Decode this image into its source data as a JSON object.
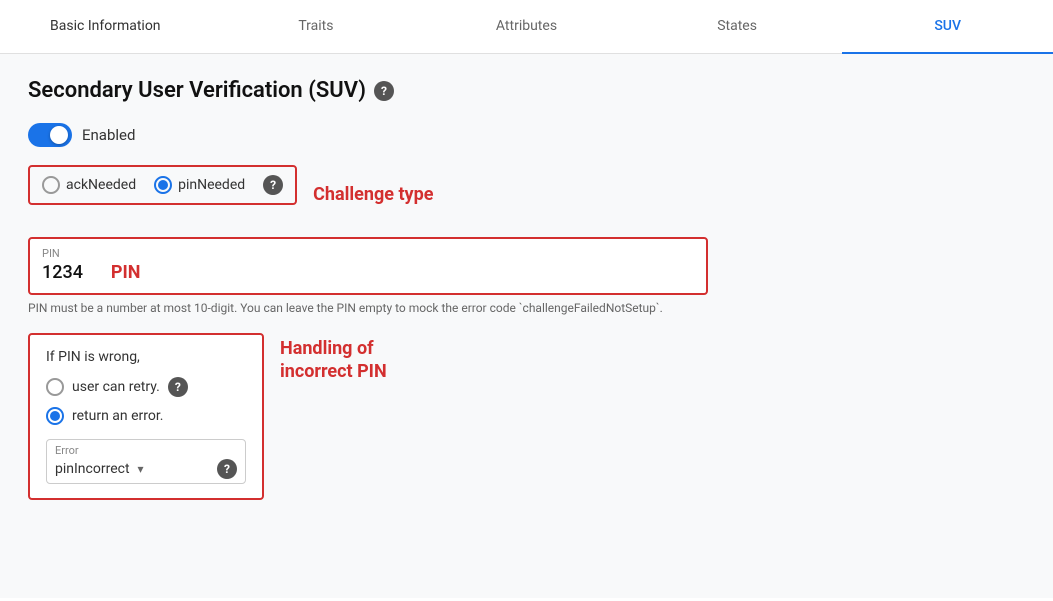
{
  "tabs": [
    {
      "id": "basic-information",
      "label": "Basic Information",
      "active": false
    },
    {
      "id": "traits",
      "label": "Traits",
      "active": false
    },
    {
      "id": "attributes",
      "label": "Attributes",
      "active": false
    },
    {
      "id": "states",
      "label": "States",
      "active": false
    },
    {
      "id": "suv",
      "label": "SUV",
      "active": true
    }
  ],
  "page": {
    "title": "Secondary User Verification (SUV)",
    "enabled_label": "Enabled",
    "toggle_on": true,
    "challenge_type_label": "Challenge type",
    "radio_options": [
      {
        "id": "ackNeeded",
        "label": "ackNeeded",
        "checked": false
      },
      {
        "id": "pinNeeded",
        "label": "pinNeeded",
        "checked": true
      }
    ],
    "pin_section": {
      "field_label": "PIN",
      "value": "1234",
      "label_red": "PIN",
      "hint": "PIN must be a number at most 10-digit. You can leave the PIN empty to mock the error code `challengeFailedNotSetup`."
    },
    "incorrect_pin": {
      "if_wrong_text": "If PIN is wrong,",
      "options": [
        {
          "id": "retry",
          "label": "user can retry.",
          "checked": false
        },
        {
          "id": "error",
          "label": "return an error.",
          "checked": true
        }
      ],
      "error_field_label": "Error",
      "error_value": "pinIncorrect",
      "handling_label": "Handling of\nincorrect PIN"
    }
  },
  "icons": {
    "help": "?",
    "chevron_down": "▾"
  }
}
